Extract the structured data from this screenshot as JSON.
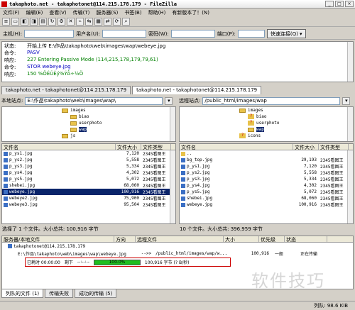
{
  "window": {
    "title": "takaphoto.net - takaphotonet@114.215.178.179 - FileZilla"
  },
  "window_buttons": [
    "_",
    "□",
    "×"
  ],
  "menu": [
    "文件(F)",
    "编辑(E)",
    "查看(V)",
    "传输(T)",
    "服务器(S)",
    "书签(B)",
    "帮助(H)",
    "有新版本了！(N)"
  ],
  "quickconnect": {
    "host_label": "主机(H):",
    "user_label": "用户名(U):",
    "pass_label": "密码(W):",
    "port_label": "端口(P):",
    "connect_label": "快速连接(Q)"
  },
  "log": [
    {
      "label": "状态:",
      "text": "开始上传 E:\\作品\\takaphoto\\web\\images\\wap\\webeye.jpg",
      "color": "#000000"
    },
    {
      "label": "命令:",
      "text": "PASV",
      "color": "#0000c0"
    },
    {
      "label": "响应:",
      "text": "227 Entering Passive Mode (114,215,178,179,79,61)",
      "color": "#008000"
    },
    {
      "label": "命令:",
      "text": "STOR webeye.jpg",
      "color": "#0000c0"
    },
    {
      "label": "响应:",
      "text": "150 %ÖÉÚÈý%ÝÂ÷½Ö",
      "color": "#008000"
    }
  ],
  "tabs": [
    "takaphoto.net - takaphotonet@114.215.178.179",
    "takaphoto.net - takaphotonet@114.215.178.179"
  ],
  "local": {
    "site_label": "本地站点:",
    "path": "E:\\作品\\takaphoto\\web\\images\\wap\\",
    "tree": [
      {
        "name": "images",
        "indent": 0,
        "type": "folder"
      },
      {
        "name": "biao",
        "indent": 1,
        "type": "folder"
      },
      {
        "name": "userphoto",
        "indent": 1,
        "type": "folder"
      },
      {
        "name": "wap",
        "indent": 1,
        "type": "folder",
        "selected": true
      },
      {
        "name": "js",
        "indent": 0,
        "type": "folder"
      }
    ],
    "headers": [
      "文件名",
      "文件大小",
      "文件类型"
    ],
    "files": [
      {
        "name": "p_ys1.jpg",
        "size": "7,120",
        "type": "2345看图王"
      },
      {
        "name": "p_ys2.jpg",
        "size": "5,558",
        "type": "2345看图王"
      },
      {
        "name": "p_ys3.jpg",
        "size": "5,334",
        "type": "2345看图王"
      },
      {
        "name": "p_ys4.jpg",
        "size": "4,302",
        "type": "2345看图王"
      },
      {
        "name": "p_ys5.jpg",
        "size": "5,072",
        "type": "2345看图王"
      },
      {
        "name": "shebei.jpg",
        "size": "68,060",
        "type": "2345看图王"
      },
      {
        "name": "webeye.jpg",
        "size": "100,916",
        "type": "2345看图王",
        "selected": true
      },
      {
        "name": "webeye2.jpg",
        "size": "75,900",
        "type": "2345看图王"
      },
      {
        "name": "webeye3.jpg",
        "size": "95,504",
        "type": "2345看图王"
      }
    ],
    "status": "选择了 1 个文件。大小总共: 100,916 字节"
  },
  "remote": {
    "site_label": "远程站点:",
    "path": "/public_html/images/wap",
    "tree": [
      {
        "name": "images",
        "indent": 0,
        "type": "folder"
      },
      {
        "name": "biao",
        "indent": 1,
        "type": "qfolder"
      },
      {
        "name": "userphoto",
        "indent": 1,
        "type": "qfolder"
      },
      {
        "name": "wap",
        "indent": 1,
        "type": "folder",
        "selected": true
      },
      {
        "name": "icons",
        "indent": 0,
        "type": "qfolder"
      }
    ],
    "headers": [
      "文件名",
      "文件大小",
      "文件类型"
    ],
    "files": [
      {
        "name": "..",
        "size": "",
        "type": ""
      },
      {
        "name": "bg_top.jpg",
        "size": "29,193",
        "type": "2345看图王"
      },
      {
        "name": "p_ys1.jpg",
        "size": "7,120",
        "type": "2345看图王"
      },
      {
        "name": "p_ys2.jpg",
        "size": "5,558",
        "type": "2345看图王"
      },
      {
        "name": "p_ys3.jpg",
        "size": "5,334",
        "type": "2345看图王"
      },
      {
        "name": "p_ys4.jpg",
        "size": "4,302",
        "type": "2345看图王"
      },
      {
        "name": "p_ys5.jpg",
        "size": "5,072",
        "type": "2345看图王"
      },
      {
        "name": "shebei.jpg",
        "size": "68,060",
        "type": "2345看图王"
      },
      {
        "name": "webeye.jpg",
        "size": "100,916",
        "type": "2345看图王"
      }
    ],
    "status": "10 个文件。大小总共: 396,959 字节"
  },
  "queue": {
    "headers": [
      "服务器/本地文件",
      "方向",
      "远程文件",
      "大小",
      "优先级",
      "状态"
    ],
    "server": "takaphotonet@114.215.178.179",
    "item": {
      "local": "E:\\作品\\takaphoto\\web\\images\\wap\\webeye.jpg",
      "direction": "-->>",
      "remote": "/public_html/images/wap/w...",
      "size": "100,916",
      "priority": "一般",
      "status": "正在传输"
    },
    "progress": {
      "elapsed_label": "已耗时 00:00:00",
      "remaining_label": "剩下",
      "remaining_value": "--:--:--",
      "percent": 100.0,
      "percent_text": "100.0%",
      "bytes": "100,916 字节 (? B/秒)"
    }
  },
  "bottom_tabs": [
    "列队的文件 (1)",
    "传输失败",
    "成功的传输 (5)"
  ],
  "footer": {
    "text": "列队: 98.6 KiB"
  },
  "watermark": "软件技巧"
}
